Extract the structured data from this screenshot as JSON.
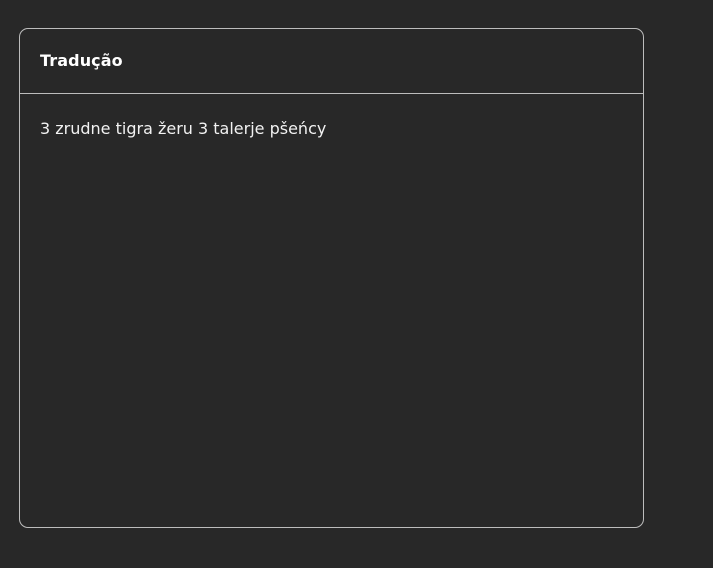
{
  "panel": {
    "title": "Tradução",
    "translation_text": "3 zrudne tigra žeru 3 talerje pšeńcy"
  }
}
